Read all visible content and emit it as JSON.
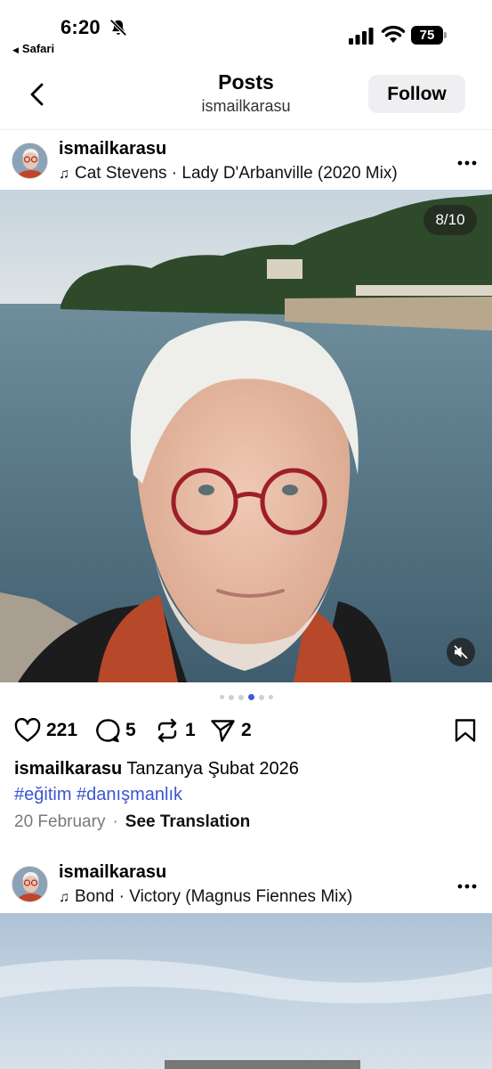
{
  "status_bar": {
    "time": "6:20",
    "back_app": "Safari",
    "battery": "75"
  },
  "header": {
    "title": "Posts",
    "subtitle": "ismailkarasu",
    "follow_label": "Follow"
  },
  "posts": [
    {
      "username": "ismailkarasu",
      "music": "Cat Stevens · Lady D'Arbanville (2020 Mix)",
      "counter": "8/10",
      "likes": "221",
      "comments": "5",
      "reposts": "1",
      "shares": "2",
      "caption_user": "ismailkarasu",
      "caption_text": "Tanzanya Şubat 2026",
      "hashtags": [
        "#eğitim",
        "#danışmanlık"
      ],
      "date": "20 February",
      "translate_label": "See Translation"
    },
    {
      "username": "ismailkarasu",
      "music": "Bond · Victory (Magnus Fiennes Mix)"
    }
  ],
  "carousel": {
    "total_dots": 6,
    "active_index": 3
  },
  "colors": {
    "accent_blue": "#3b55d1",
    "follow_bg": "#efeff2",
    "muted_text": "#7a7a7a"
  },
  "icons": [
    "bell-slash-icon",
    "signal-icon",
    "wifi-icon",
    "back-chevron-icon",
    "music-note-icon",
    "more-icon",
    "heart-icon",
    "comment-icon",
    "repost-icon",
    "share-icon",
    "bookmark-icon",
    "mute-icon"
  ]
}
